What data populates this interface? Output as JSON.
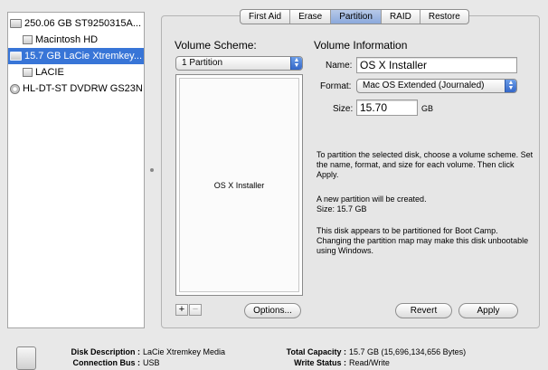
{
  "sidebar": {
    "items": [
      {
        "label": "250.06 GB ST9250315A...",
        "icon": "hard-disk-icon"
      },
      {
        "label": "Macintosh HD",
        "icon": "volume-icon"
      },
      {
        "label": "15.7 GB LaCie Xtremkey...",
        "icon": "usb-disk-icon",
        "selected": true
      },
      {
        "label": "LACIE",
        "icon": "volume-icon"
      },
      {
        "label": "HL-DT-ST DVDRW GS23N",
        "icon": "optical-drive-icon"
      }
    ]
  },
  "tabs": [
    "First Aid",
    "Erase",
    "Partition",
    "RAID",
    "Restore"
  ],
  "active_tab": "Partition",
  "volume_scheme": {
    "heading": "Volume Scheme:",
    "selected": "1 Partition",
    "partition_label": "OS X Installer"
  },
  "volume_info": {
    "heading": "Volume Information",
    "name_label": "Name:",
    "name_value": "OS X Installer",
    "format_label": "Format:",
    "format_value": "Mac OS Extended (Journaled)",
    "size_label": "Size:",
    "size_value": "15.70",
    "size_unit": "GB"
  },
  "info_texts": {
    "p1": "To partition the selected disk, choose a volume scheme. Set the name, format, and size for each volume. Then click Apply.",
    "p2a": "A new partition will be created.",
    "p2b": "Size: 15.7 GB",
    "p3": "This disk appears to be partitioned for Boot Camp. Changing the partition map may make this disk unbootable using Windows."
  },
  "buttons": {
    "add": "+",
    "remove": "−",
    "options": "Options...",
    "revert": "Revert",
    "apply": "Apply"
  },
  "bottom_info": {
    "disk_description_label": "Disk Description :",
    "disk_description_value": "LaCie Xtremkey Media",
    "connection_bus_label": "Connection Bus :",
    "connection_bus_value": "USB",
    "total_capacity_label": "Total Capacity :",
    "total_capacity_value": "15.7 GB (15,696,134,656 Bytes)",
    "write_status_label": "Write Status :",
    "write_status_value": "Read/Write"
  },
  "colors": {
    "selection": "#3875d7",
    "popup_arrow": "#3467c8"
  }
}
